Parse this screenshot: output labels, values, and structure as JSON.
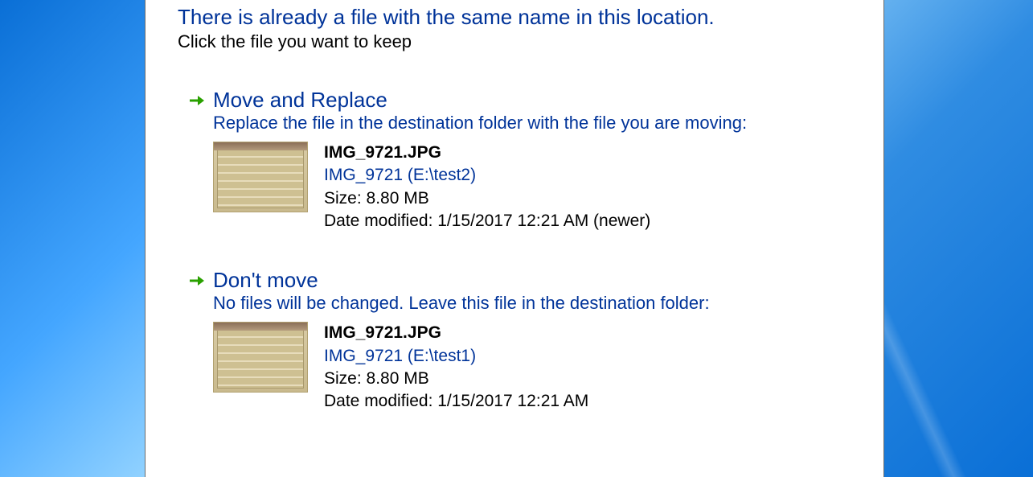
{
  "dialog": {
    "heading": "There is already a file with the same name in this location.",
    "subheading": "Click the file you want to keep",
    "options": {
      "replace": {
        "title": "Move and Replace",
        "desc": "Replace the file in the destination folder with the file you are moving:",
        "file": {
          "name": "IMG_9721.JPG",
          "location": "IMG_9721 (E:\\test2)",
          "size": "Size: 8.80 MB",
          "modified": "Date modified: 1/15/2017 12:21 AM (newer)"
        }
      },
      "dontmove": {
        "title": "Don't move",
        "desc": "No files will be changed. Leave this file in the destination folder:",
        "file": {
          "name": "IMG_9721.JPG",
          "location": "IMG_9721 (E:\\test1)",
          "size": "Size: 8.80 MB",
          "modified": "Date modified: 1/15/2017 12:21 AM"
        }
      }
    }
  }
}
